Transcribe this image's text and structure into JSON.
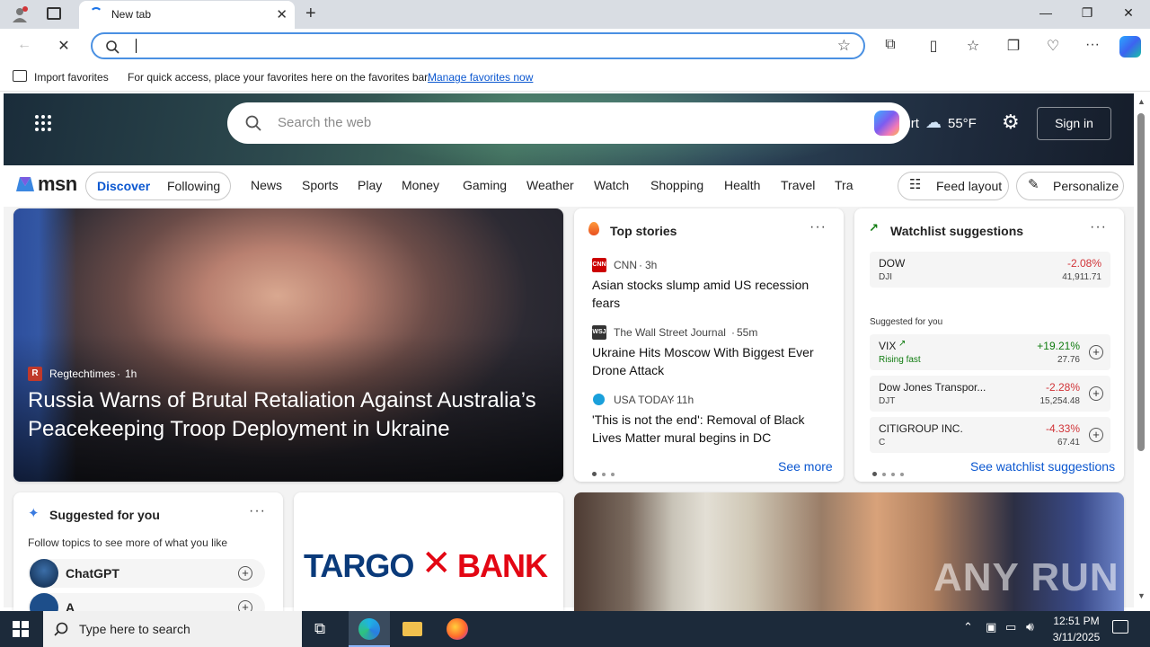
{
  "browser": {
    "tab_title": "New tab",
    "address_value": "",
    "favorites": {
      "import_label": "Import favorites",
      "message": "For quick access, place your favorites here on the favorites bar.",
      "manage_link": "Manage favorites now"
    }
  },
  "msn": {
    "search_placeholder": "Search the web",
    "city": "ankfurt",
    "temperature": "55°F",
    "signin": "Sign in",
    "brand": "msn",
    "tabs": [
      "Discover",
      "Following"
    ],
    "nav": [
      "News",
      "Sports",
      "Play",
      "Money",
      "Gaming",
      "Weather",
      "Watch",
      "Shopping",
      "Health",
      "Travel",
      "Tra"
    ],
    "feed_layout": "Feed layout",
    "personalize": "Personalize"
  },
  "hero": {
    "source": "Regtechtimes",
    "time": "1h",
    "source_initial": "R",
    "headline": "Russia Warns of Brutal Retaliation Against Australia’s Peacekeeping Troop Deployment in Ukraine"
  },
  "top_stories": {
    "title": "Top stories",
    "see_more": "See more",
    "items": [
      {
        "source": "CNN",
        "time": "3h",
        "logo": "CNN",
        "headline": "Asian stocks slump amid US recession fears"
      },
      {
        "source": "The Wall Street Journal",
        "time": "55m",
        "logo": "WSJ",
        "headline": "Ukraine Hits Moscow With Biggest Ever Drone Attack"
      },
      {
        "source": "USA TODAY",
        "time": "11h",
        "logo": "",
        "headline": "'This is not the end': Removal of Black Lives Matter mural begins in DC"
      }
    ]
  },
  "watchlist": {
    "title": "Watchlist suggestions",
    "suggested_label": "Suggested for you",
    "see_link": "See watchlist suggestions",
    "main": {
      "name": "DOW",
      "symbol": "DJI",
      "change": "-2.08%",
      "value": "41,911.71"
    },
    "items": [
      {
        "name": "VIX",
        "symbol": "Rising fast",
        "change": "+19.21%",
        "value": "27.76"
      },
      {
        "name": "Dow Jones Transpor...",
        "symbol": "DJT",
        "change": "-2.28%",
        "value": "15,254.48"
      },
      {
        "name": "CITIGROUP INC.",
        "symbol": "C",
        "change": "-4.33%",
        "value": "67.41"
      }
    ]
  },
  "suggested": {
    "title": "Suggested for you",
    "subtitle": "Follow topics to see more of what you like",
    "topics": [
      "ChatGPT",
      "A"
    ]
  },
  "ad": {
    "brand_left": "TARGO",
    "brand_right": "BANK"
  },
  "watermark": "ANY RUN",
  "taskbar": {
    "search_placeholder": "Type here to search",
    "time": "12:51 PM",
    "date": "3/11/2025"
  },
  "colors": {
    "accent": "#0b57d0",
    "negative": "#d13438",
    "positive": "#107c10",
    "targo": "#0a3a7a",
    "targo_red": "#e30613"
  }
}
